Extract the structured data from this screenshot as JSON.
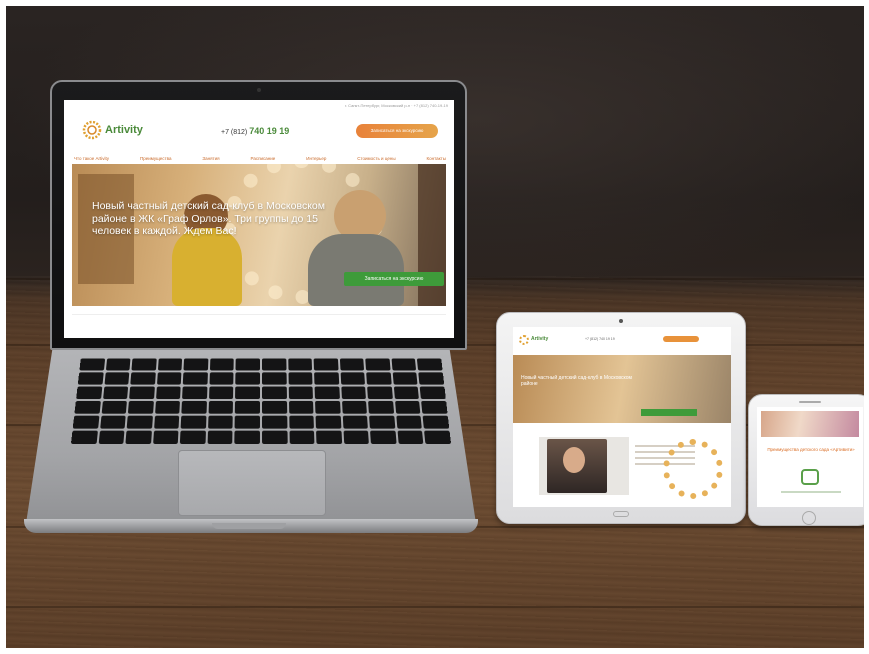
{
  "laptop_site": {
    "topbar": "г. Санкт-Петербург, Московский р-н  ·  +7 (812) 740-19-19",
    "brand": "Artivity",
    "phone_prefix": "+7 (812)",
    "phone_number": "740 19 19",
    "cta_label": "Записаться на экскурсию",
    "nav": [
      "Что такое Artivity",
      "Преимущества",
      "Занятия",
      "Расписание",
      "Интерьер",
      "Стоимость и цены",
      "Контакты"
    ],
    "hero_text": "Новый частный детский сад-клуб в Московском районе в ЖК «Граф Орлов». Три группы до 15 человек в каждой. Ждем Вас!",
    "hero_button": "Записаться на экскурсию"
  },
  "tablet_site": {
    "brand": "Artivity",
    "phone": "+7 (812) 740 19 19",
    "hero_text": "Новый частный детский сад-клуб в Московском районе"
  },
  "phone_site": {
    "title": "Преимущества детского сада «Артивити»"
  },
  "colors": {
    "brand_green": "#4a8a3a",
    "accent_orange": "#e8823a",
    "button_green": "#3e9b3a"
  }
}
